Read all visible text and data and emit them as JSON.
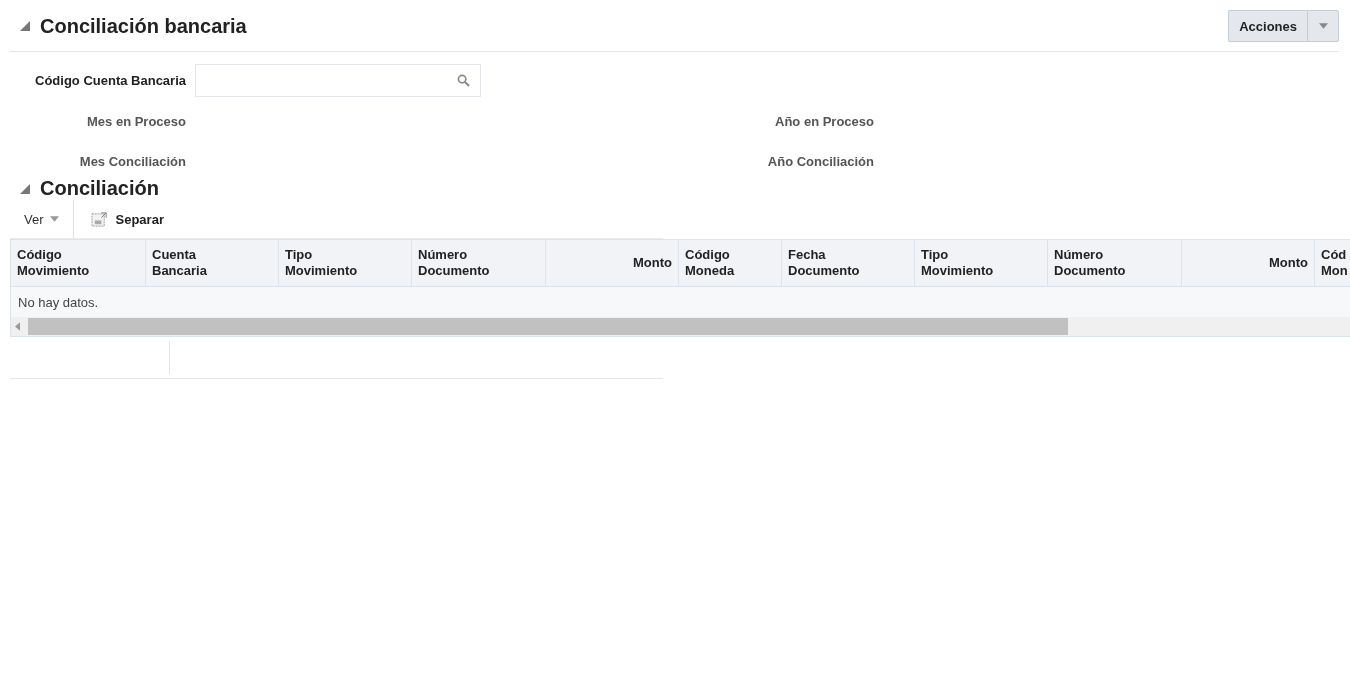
{
  "header": {
    "title": "Conciliación bancaria",
    "expanded": true,
    "actions_button": "Acciones"
  },
  "form": {
    "search_field": {
      "label": "Código Cuenta Bancaria"
    },
    "left_labels": [
      "Mes en Proceso",
      "Mes Conciliación"
    ],
    "right_labels": [
      "Año en Proceso",
      "Año Conciliación"
    ]
  },
  "section": {
    "title": "Conciliación",
    "expanded": true
  },
  "toolbar": {
    "view_menu": "Ver",
    "detach_button": "Separar"
  },
  "table": {
    "columns": [
      {
        "label": "Código\nMovimiento",
        "kind": "text"
      },
      {
        "label": "Cuenta\nBancaria",
        "kind": "text"
      },
      {
        "label": "Tipo\nMovimiento",
        "kind": "text"
      },
      {
        "label": "Número\nDocumento",
        "kind": "text"
      },
      {
        "label": "Monto",
        "kind": "amount"
      },
      {
        "label": "Código\nMoneda",
        "kind": "text"
      },
      {
        "label": "Fecha\nDocumento",
        "kind": "text"
      },
      {
        "label": "Tipo\nMovimiento",
        "kind": "text"
      },
      {
        "label": "Número\nDocumento",
        "kind": "text"
      },
      {
        "label": "Monto",
        "kind": "amount"
      },
      {
        "label": "Cód\nMon",
        "kind": "text"
      }
    ],
    "empty_message": "No hay datos."
  }
}
